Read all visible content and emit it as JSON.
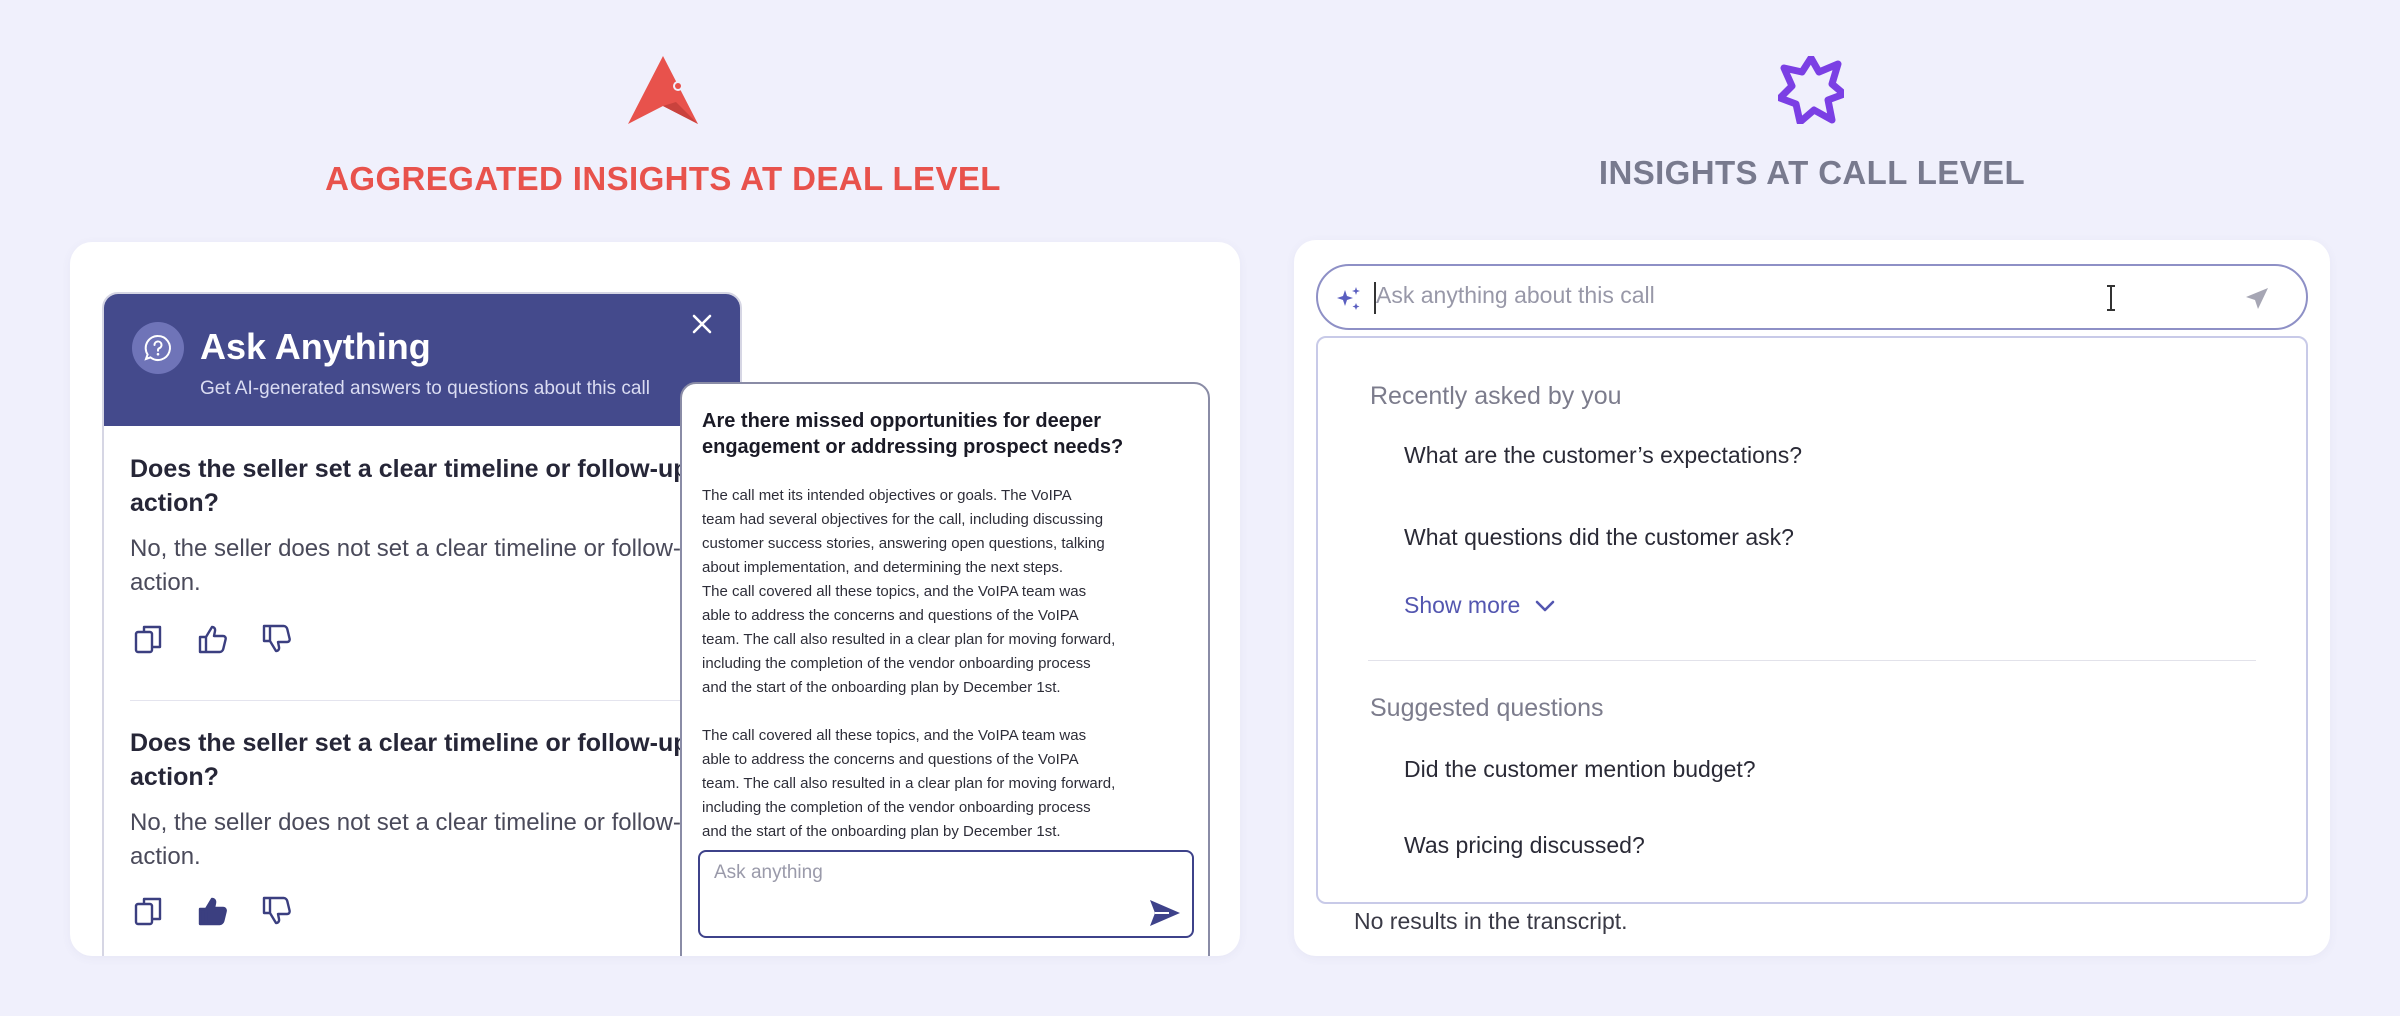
{
  "left_section": {
    "title": "AGGREGATED INSIGHTS AT DEAL LEVEL",
    "logo_icon": "brand-a-logo-icon",
    "accent_color": "#e8524c"
  },
  "right_section": {
    "title": "INSIGHTS AT CALL LEVEL",
    "logo_icon": "burst-sparkle-logo-icon",
    "accent_color": "#7b3fe4"
  },
  "ask_panel": {
    "title": "Ask Anything",
    "subtitle": "Get AI-generated answers to questions about this call",
    "header_color": "#444a8c",
    "qa_items": [
      {
        "question": "Does the seller set a clear timeline or follow-up action?",
        "answer": "No, the seller does not set a clear timeline or follow-up action.",
        "feedback": {
          "copy": "copy-icon",
          "thumbs_up": "thumbs-up-outline-icon",
          "thumbs_down": "thumbs-down-outline-icon"
        }
      },
      {
        "question": "Does the seller set a clear timeline or follow-up action?",
        "answer": "No, the seller does not set a clear timeline or follow-up action.",
        "feedback": {
          "copy": "copy-icon",
          "thumbs_up": "thumbs-up-filled-icon",
          "thumbs_down": "thumbs-down-outline-icon"
        }
      }
    ]
  },
  "answer_panel": {
    "question": "Are there missed opportunities for deeper engagement or addressing prospect needs?",
    "body": "The call met its intended objectives or goals. The VoIPA\nteam had several objectives for the call, including discussing\ncustomer success stories, answering open questions, talking\nabout implementation, and determining the next steps.\nThe call covered all these topics, and the VoIPA team was\nable to address the concerns and questions of the VoIPA\nteam. The call also resulted in a clear plan for moving forward,\nincluding the completion of the vendor onboarding process\nand the start of the onboarding plan by December 1st.\n\nThe call covered all these topics, and the VoIPA team was\nable to address the concerns and questions of the VoIPA\nteam. The call also resulted in a clear plan for moving forward,\nincluding the completion of the vendor onboarding process\nand the start of the onboarding plan by December 1st.",
    "input_placeholder": "Ask anything",
    "input_value": ""
  },
  "call_search": {
    "placeholder": "Ask anything about this call",
    "value": "",
    "recent_heading": "Recently asked by you",
    "recent_items": [
      "What are the customer’s expectations?",
      "What questions did the customer ask?"
    ],
    "show_more_label": "Show more",
    "suggested_heading": "Suggested questions",
    "suggested_items": [
      "Did the customer mention budget?",
      "Was pricing discussed?"
    ],
    "no_results": "No results in the transcript."
  }
}
